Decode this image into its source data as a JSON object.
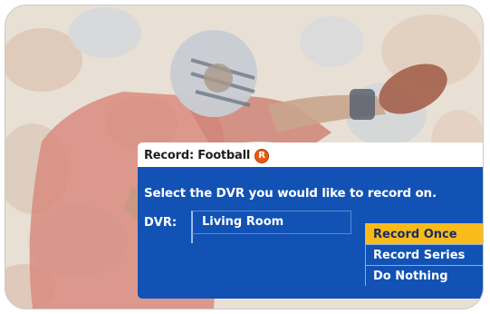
{
  "dialog": {
    "title": "Record: Football",
    "rating_badge": "R",
    "rating_color": "#e75b14",
    "prompt": "Select the DVR you would like to record on.",
    "dvr_label": "DVR:",
    "dvr_value": "Living Room"
  },
  "menu": {
    "items": [
      {
        "label": "Record Once",
        "selected": true
      },
      {
        "label": "Record Series",
        "selected": false
      },
      {
        "label": "Do Nothing",
        "selected": false
      }
    ]
  },
  "colors": {
    "dialog_bg": "#1152b4",
    "highlight": "#f7bb1b",
    "header_bg": "#ffffff"
  }
}
